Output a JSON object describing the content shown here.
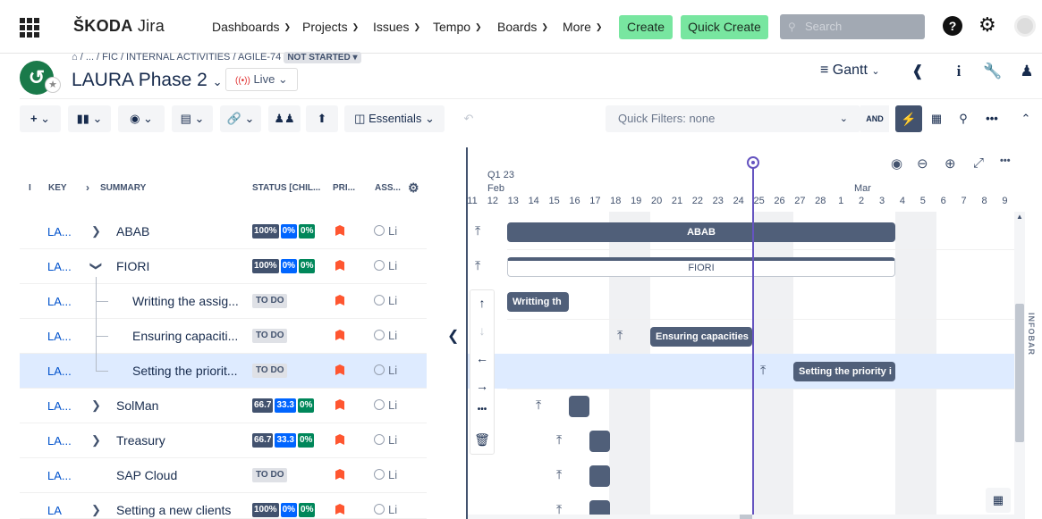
{
  "nav": {
    "brand_main": "ŠKODA",
    "brand_sub": " Jira",
    "items": [
      "Dashboards",
      "Projects",
      "Issues",
      "Tempo",
      "Boards",
      "More"
    ],
    "create": "Create",
    "quick_create": "Quick Create",
    "search_placeholder": "Search"
  },
  "header": {
    "breadcrumb_path": "/ ... / FIC / INTERNAL ACTIVITIES / AGILE-74",
    "status_badge": "NOT STARTED",
    "title": "LAURA Phase 2",
    "live": "Live",
    "view": "Gantt"
  },
  "toolbar": {
    "essentials": "Essentials",
    "quick_filters": "Quick Filters: none",
    "and": "AND"
  },
  "table": {
    "headers": {
      "index": "I",
      "key": "KEY",
      "summary": "SUMMARY",
      "status": "STATUS [CHIL...",
      "priority": "PRI...",
      "assignee": "ASS..."
    },
    "rows": [
      {
        "key": "LA...",
        "summary": "ABAB",
        "status": [
          "100%",
          "0%",
          "0%"
        ],
        "assignee": "Li"
      },
      {
        "key": "LA...",
        "summary": "FIORI",
        "status": [
          "100%",
          "0%",
          "0%"
        ],
        "assignee": "Li"
      },
      {
        "key": "LA...",
        "summary": "Writting the assig...",
        "status_text": "TO DO",
        "assignee": "Li"
      },
      {
        "key": "LA...",
        "summary": "Ensuring capaciti...",
        "status_text": "TO DO",
        "assignee": "Li"
      },
      {
        "key": "LA...",
        "summary": "Setting the priorit...",
        "status_text": "TO DO",
        "assignee": "Li"
      },
      {
        "key": "LA...",
        "summary": "SolMan",
        "status": [
          "66.7",
          "33.3",
          "0%"
        ],
        "assignee": "Li"
      },
      {
        "key": "LA...",
        "summary": "Treasury",
        "status": [
          "66.7",
          "33.3",
          "0%"
        ],
        "assignee": "Li"
      },
      {
        "key": "LA...",
        "summary": "SAP Cloud",
        "status_text": "TO DO",
        "assignee": "Li"
      },
      {
        "key": "LA",
        "summary": "Setting a new clients",
        "status": [
          "100%",
          "0%",
          "0%"
        ],
        "assignee": "Li"
      }
    ]
  },
  "gantt": {
    "quarter": "Q1 23",
    "month_feb": "Feb",
    "month_mar": "Mar",
    "days": [
      "11",
      "12",
      "13",
      "14",
      "15",
      "16",
      "17",
      "18",
      "19",
      "20",
      "21",
      "22",
      "23",
      "24",
      "25",
      "26",
      "27",
      "28",
      "1",
      "2",
      "3",
      "4",
      "5",
      "6",
      "7",
      "8",
      "9"
    ],
    "bars": {
      "abab": "ABAB",
      "fiori": "FIORI",
      "writting": "Writting th",
      "ensuring": "Ensuring capacities",
      "setting": "Setting the priority i"
    },
    "infobar": "INFOBAR"
  }
}
